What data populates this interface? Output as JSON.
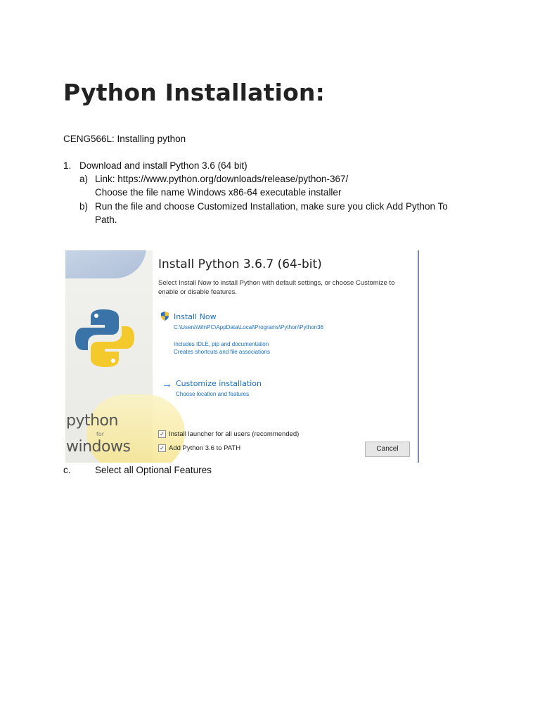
{
  "document": {
    "title": "Python Installation:",
    "subtitle": "CENG566L: Installing python",
    "step1": {
      "number": "1.",
      "text": "Download and install Python 3.6 (64 bit)",
      "a": {
        "label": "a)",
        "link": "Link: https://www.python.org/downloads/release/python-367/",
        "note": "Choose the file name Windows x86-64 executable installer"
      },
      "b": {
        "label": "b)",
        "text": "Run the file and choose Customized Installation, make sure you click Add Python To Path."
      }
    },
    "step_c": {
      "label": "c.",
      "text": "Select all Optional Features"
    }
  },
  "installer": {
    "brand": {
      "word1": "python",
      "for": "for",
      "word2": "windows"
    },
    "title": "Install Python 3.6.7 (64-bit)",
    "description": "Select Install Now to install Python with default settings, or choose Customize to enable or disable features.",
    "install_now": {
      "icon": "shield-icon",
      "label": "Install Now",
      "path": "C:\\Users\\WinPC\\AppData\\Local\\Programs\\Python\\Python36",
      "info1": "Includes IDLE, pip and documentation",
      "info2": "Creates shortcuts and file associations"
    },
    "customize": {
      "icon": "arrow-right-icon",
      "label": "Customize installation",
      "sub": "Choose location and features"
    },
    "checkboxes": [
      {
        "label": "Install launcher for all users (recommended)",
        "checked": true
      },
      {
        "label": "Add Python 3.6 to PATH",
        "checked": true
      }
    ],
    "cancel_label": "Cancel",
    "colors": {
      "link_blue": "#1a6fc4",
      "python_blue": "#3a73a8",
      "python_yellow": "#f3c92c"
    }
  }
}
